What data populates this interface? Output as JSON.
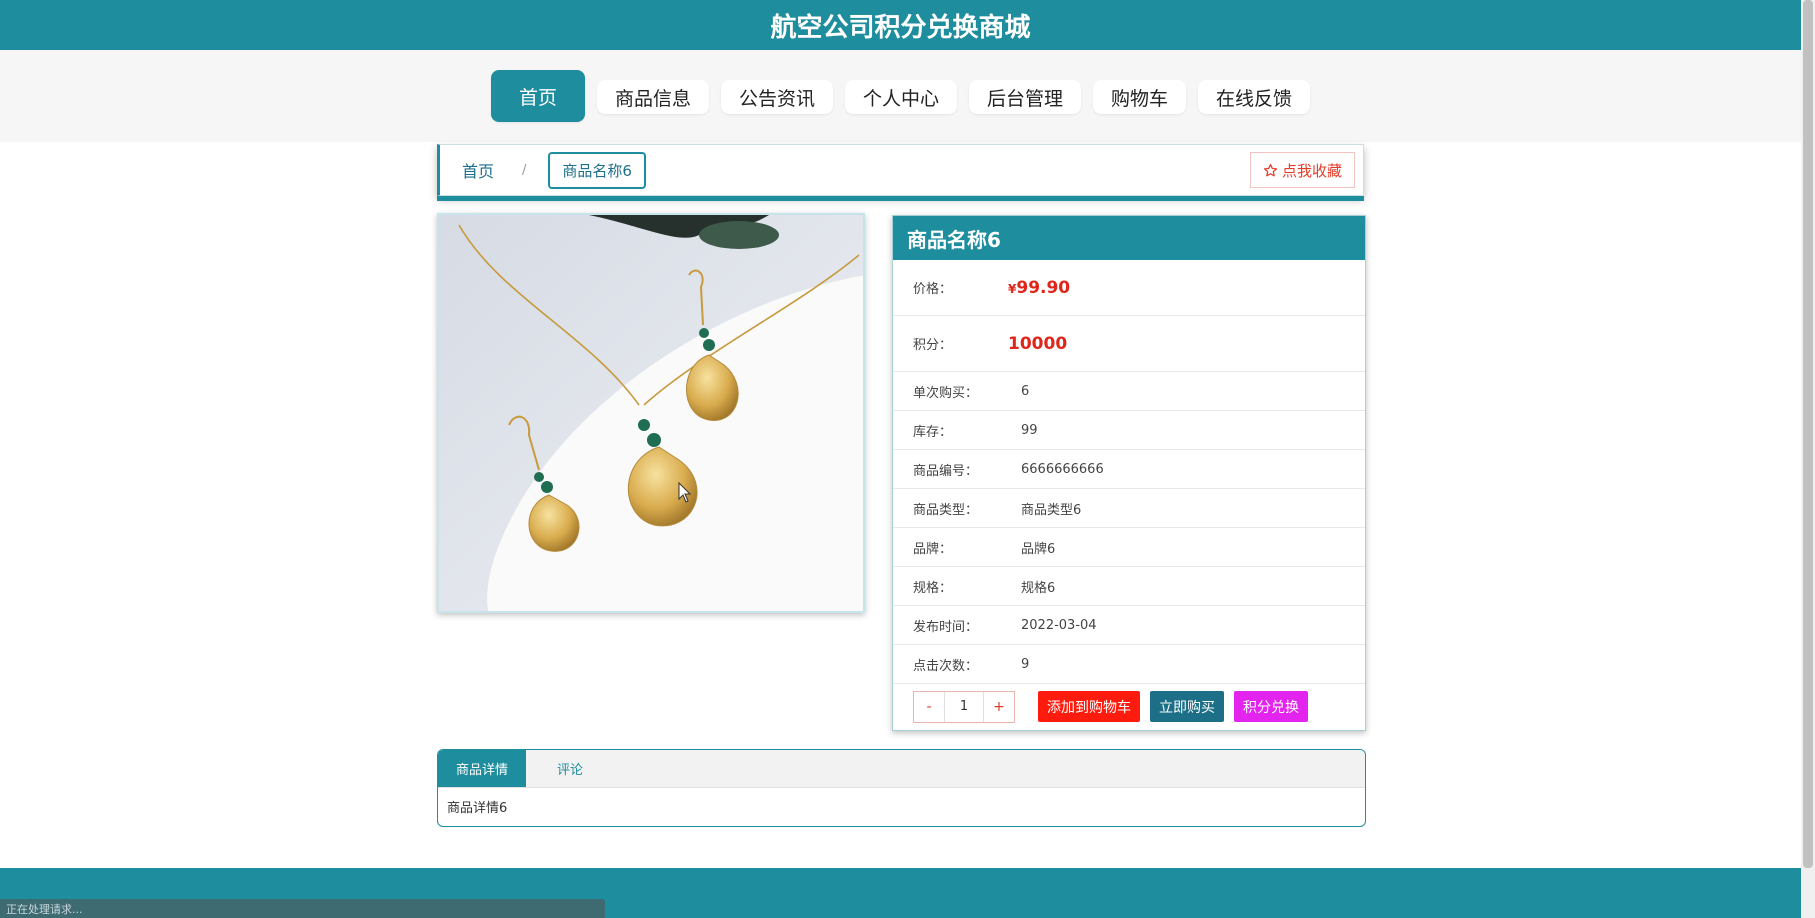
{
  "app": {
    "title": "航空公司积分兑换商城",
    "status_text": "正在处理请求..."
  },
  "nav": {
    "items": [
      {
        "label": "首页",
        "active": true
      },
      {
        "label": "商品信息"
      },
      {
        "label": "公告资讯"
      },
      {
        "label": "个人中心"
      },
      {
        "label": "后台管理"
      },
      {
        "label": "购物车"
      },
      {
        "label": "在线反馈"
      }
    ]
  },
  "breadcrumb": {
    "home": "首页",
    "separator": "/",
    "current": "商品名称6"
  },
  "favorite": {
    "icon": "star-outline-icon",
    "label": "点我收藏"
  },
  "product": {
    "name": "商品名称6",
    "price_currency": "¥",
    "price": "99.90",
    "points": "10000",
    "fields": [
      {
        "label": "价格："
      },
      {
        "label": "积分："
      },
      {
        "label": "单次购买：",
        "value": "6"
      },
      {
        "label": "库存：",
        "value": "99"
      },
      {
        "label": "商品编号：",
        "value": "6666666666"
      },
      {
        "label": "商品类型：",
        "value": "商品类型6"
      },
      {
        "label": "品牌：",
        "value": "品牌6"
      },
      {
        "label": "规格：",
        "value": "规格6"
      },
      {
        "label": "发布时间：",
        "value": "2022-03-04"
      },
      {
        "label": "点击次数：",
        "value": "9"
      }
    ]
  },
  "purchase": {
    "minus": "-",
    "quantity": "1",
    "plus": "+",
    "add_to_cart": "添加到购物车",
    "buy_now": "立即购买",
    "points_exchange": "积分兑换"
  },
  "tabs": {
    "items": [
      {
        "label": "商品详情",
        "active": true
      },
      {
        "label": "评论"
      }
    ],
    "content": "商品详情6"
  },
  "colors": {
    "primary": "#1e8e9e",
    "price": "#e0251b",
    "cart": "#ff1c0e",
    "buy": "#1d6f88",
    "points": "#e324ee"
  }
}
